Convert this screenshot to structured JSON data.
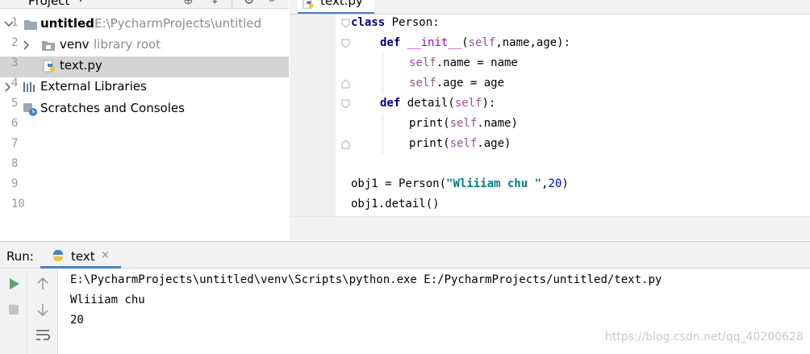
{
  "project": {
    "title": "Project",
    "tree": {
      "root_name": "untitled",
      "root_path": "E:\\PycharmProjects\\untitled",
      "venv_name": "venv",
      "venv_note": "library root",
      "file_name": "text.py",
      "external_libraries": "External Libraries",
      "scratches": "Scratches and Consoles"
    }
  },
  "editor": {
    "tab_label": "text.py",
    "line_numbers": [
      "1",
      "2",
      "3",
      "4",
      "5",
      "6",
      "7",
      "8",
      "9",
      "10"
    ],
    "code": {
      "l1_kw": "class",
      "l1_rest": " Person:",
      "l2_kw": "def",
      "l2_magic": "__init__",
      "l2_open": "(",
      "l2_self": "self",
      "l2_rest": ",name,age):",
      "l3_self": "self",
      "l3_rest": ".name = name",
      "l4_self": "self",
      "l4_rest": ".age = age",
      "l5_kw": "def",
      "l5_name": " detail(",
      "l5_self": "self",
      "l5_close": "):",
      "l6_fn": "print(",
      "l6_self": "self",
      "l6_rest": ".name)",
      "l7_fn": "print(",
      "l7_self": "self",
      "l7_rest": ".age)",
      "l9_start": "obj1 = Person(",
      "l9_str": "\"Wliiiam chu \"",
      "l9_comma": ",",
      "l9_num": "20",
      "l9_end": ")",
      "l10": "obj1.detail()"
    }
  },
  "run": {
    "label": "Run:",
    "tab_label": "text",
    "close_glyph": "×",
    "output": [
      "E:\\PycharmProjects\\untitled\\venv\\Scripts\\python.exe E:/PycharmProjects/untitled/text.py",
      "Wliiiam chu",
      "20"
    ]
  },
  "watermark": "https://blog.csdn.net/qq_40200628",
  "colors": {
    "accent_blue": "#4083c9",
    "run_green": "#59a869",
    "keyword": "#000080",
    "self_purple": "#94558d",
    "string_teal": "#008080",
    "number_blue": "#0000ff"
  }
}
